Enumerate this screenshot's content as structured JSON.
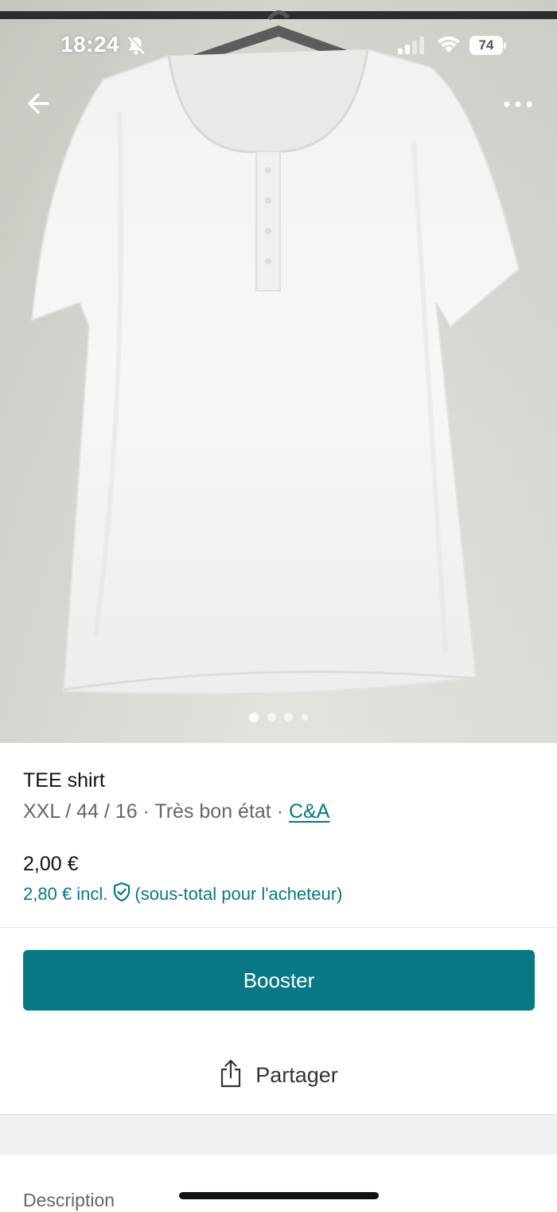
{
  "status_bar": {
    "time": "18:24",
    "battery": "74",
    "icons": [
      "bell-slash-icon",
      "signal-icon",
      "wifi-icon",
      "battery-icon"
    ]
  },
  "nav": {
    "back_icon": "arrow-left-icon",
    "more_icon": "more-horizontal-icon"
  },
  "gallery": {
    "photo_count": 4,
    "current_index": 0
  },
  "item": {
    "title": "TEE shirt",
    "details": "XXL / 44 / 16 · Très bon état · ",
    "brand": "C&A",
    "price": "2,00 €",
    "buyer_price": "2,80 € incl.",
    "buyer_price_note": "(sous-total pour l'acheteur)"
  },
  "actions": {
    "booster_label": "Booster",
    "share_label": "Partager"
  },
  "description": {
    "label": "Description"
  },
  "colors": {
    "accent": "#077884",
    "link": "#067886"
  }
}
